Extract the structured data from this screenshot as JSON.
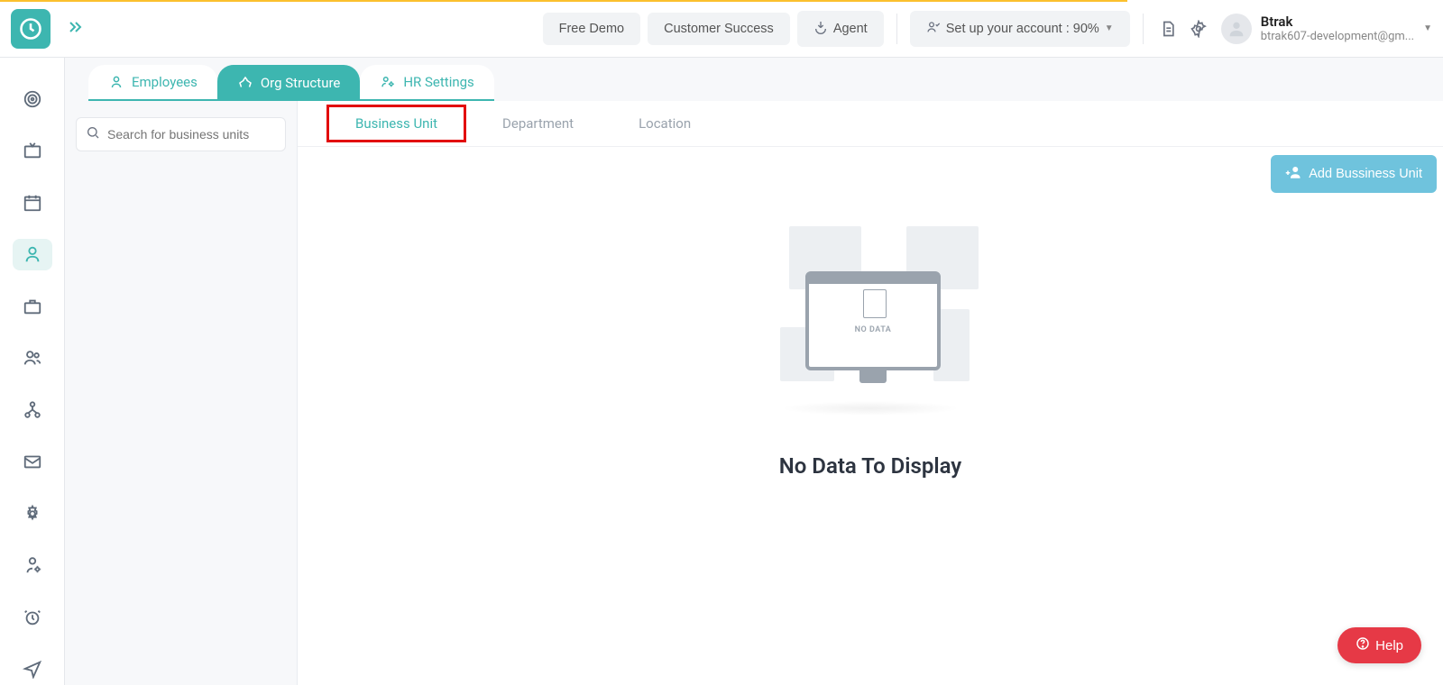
{
  "header": {
    "free_demo": "Free Demo",
    "customer_success": "Customer Success",
    "agent": "Agent",
    "setup_account": "Set up your account : 90%",
    "user_name": "Btrak",
    "user_email": "btrak607-development@gm..."
  },
  "sidebar": {
    "items": [
      {
        "name": "target"
      },
      {
        "name": "tv"
      },
      {
        "name": "calendar"
      },
      {
        "name": "people",
        "active": true
      },
      {
        "name": "briefcase"
      },
      {
        "name": "users-pair"
      },
      {
        "name": "org"
      },
      {
        "name": "mail"
      },
      {
        "name": "gear"
      },
      {
        "name": "person-manage"
      },
      {
        "name": "alarm"
      },
      {
        "name": "send"
      }
    ]
  },
  "primary_tabs": {
    "employees": "Employees",
    "org_structure": "Org Structure",
    "hr_settings": "HR Settings"
  },
  "search": {
    "placeholder": "Search for business units"
  },
  "sub_tabs": {
    "business_unit": "Business Unit",
    "department": "Department",
    "location": "Location"
  },
  "buttons": {
    "add_unit": "Add Bussiness Unit",
    "help": "Help"
  },
  "empty": {
    "illust_text": "NO DATA",
    "title": "No Data To Display"
  }
}
